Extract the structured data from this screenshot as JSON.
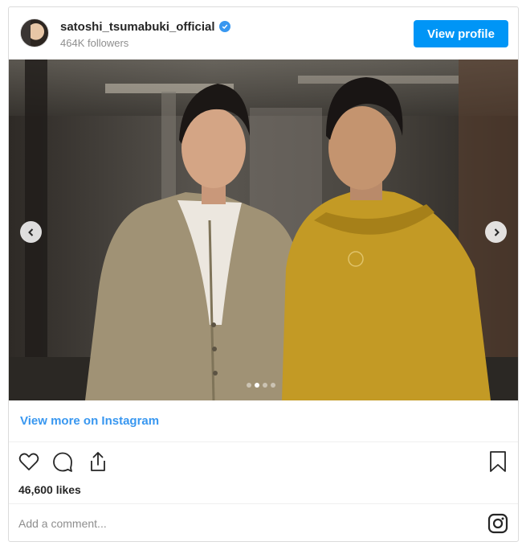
{
  "header": {
    "username": "satoshi_tsumabuki_official",
    "followers": "464K followers",
    "view_profile_label": "View profile",
    "verified_icon": "verified-badge-icon"
  },
  "photo": {
    "dots_total": 4,
    "active_dot": 2,
    "nav_prev_icon": "chevron-left-icon",
    "nav_next_icon": "chevron-right-icon"
  },
  "link": {
    "view_more_label": "View more on Instagram"
  },
  "actions": {
    "like_icon": "heart-icon",
    "comment_icon": "comment-icon",
    "share_icon": "share-icon",
    "save_icon": "bookmark-icon",
    "likes_text": "46,600 likes"
  },
  "comment": {
    "placeholder": "Add a comment...",
    "instagram_icon": "instagram-icon"
  },
  "colors": {
    "accent": "#3897f0",
    "button": "#0095f6",
    "text": "#262626",
    "muted": "#8e8e8e"
  }
}
